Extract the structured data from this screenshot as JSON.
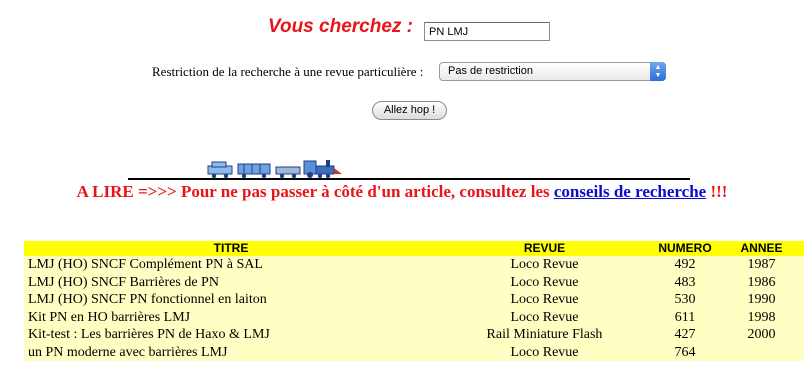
{
  "search": {
    "title": "Vous cherchez :",
    "query": "PN LMJ",
    "restriction_label": "Restriction de la recherche à une revue particulière :",
    "restriction_value": "Pas de restriction",
    "submit_label": "Allez hop !"
  },
  "notice": {
    "prefix": "A LIRE =>>> Pour ne pas passer à côté d'un article, consultez les ",
    "link": "conseils de recherche",
    "suffix": " !!!"
  },
  "table": {
    "headers": [
      "TITRE",
      "REVUE",
      "NUMERO",
      "ANNEE"
    ],
    "rows": [
      {
        "titre": "LMJ (HO) SNCF Complément PN à SAL",
        "revue": "Loco Revue",
        "numero": "492",
        "annee": "1987"
      },
      {
        "titre": "LMJ (HO) SNCF Barrières de PN",
        "revue": "Loco Revue",
        "numero": "483",
        "annee": "1986"
      },
      {
        "titre": "LMJ (HO) SNCF PN fonctionnel en laiton",
        "revue": "Loco Revue",
        "numero": "530",
        "annee": "1990"
      },
      {
        "titre": "Kit PN en HO barrières LMJ",
        "revue": "Loco Revue",
        "numero": "611",
        "annee": "1998"
      },
      {
        "titre": "Kit-test : Les barrières PN de Haxo & LMJ",
        "revue": "Rail Miniature Flash",
        "numero": "427",
        "annee": "2000"
      },
      {
        "titre": "un PN moderne avec barrières LMJ",
        "revue": "Loco Revue",
        "numero": "764",
        "annee": ""
      }
    ]
  },
  "colors": {
    "accent_red": "#e8141a",
    "link_blue": "#0c0cd1",
    "header_yellow": "#ffff00",
    "row_yellow": "#ffffc3"
  },
  "icons": {
    "train": "train-icon",
    "select_arrows": "chevron-updown-icon"
  }
}
